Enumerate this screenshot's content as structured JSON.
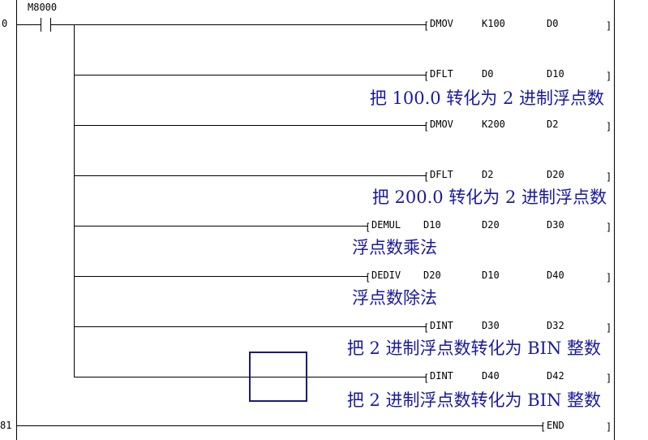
{
  "colors": {
    "wire": "#000000",
    "comment": "#1a1aa0",
    "cursor": "#1a1a7a",
    "background": "#ffffff"
  },
  "rungs": [
    {
      "step": "0",
      "contact": {
        "label": "M8000",
        "type": "normally-open-contact"
      }
    },
    {
      "step": "81"
    }
  ],
  "instructions": [
    {
      "op": "DMOV",
      "args": [
        "K100",
        "D0"
      ]
    },
    {
      "op": "DFLT",
      "args": [
        "D0",
        "D10"
      ],
      "comment": "把 100.0 转化为 2 进制浮点数"
    },
    {
      "op": "DMOV",
      "args": [
        "K200",
        "D2"
      ]
    },
    {
      "op": "DFLT",
      "args": [
        "D2",
        "D20"
      ],
      "comment": "把 200.0 转化为 2 进制浮点数"
    },
    {
      "op": "DEMUL",
      "args": [
        "D10",
        "D20",
        "D30"
      ],
      "comment": "浮点数乘法"
    },
    {
      "op": "DEDIV",
      "args": [
        "D20",
        "D10",
        "D40"
      ],
      "comment": "浮点数除法"
    },
    {
      "op": "DINT",
      "args": [
        "D30",
        "D32"
      ],
      "comment": "把 2 进制浮点数转化为 BIN 整数"
    },
    {
      "op": "DINT",
      "args": [
        "D40",
        "D42"
      ],
      "comment": "把 2 进制浮点数转化为 BIN 整数"
    }
  ],
  "end_instruction": {
    "op": "END"
  },
  "cursor": {
    "name": "selection-cursor"
  }
}
